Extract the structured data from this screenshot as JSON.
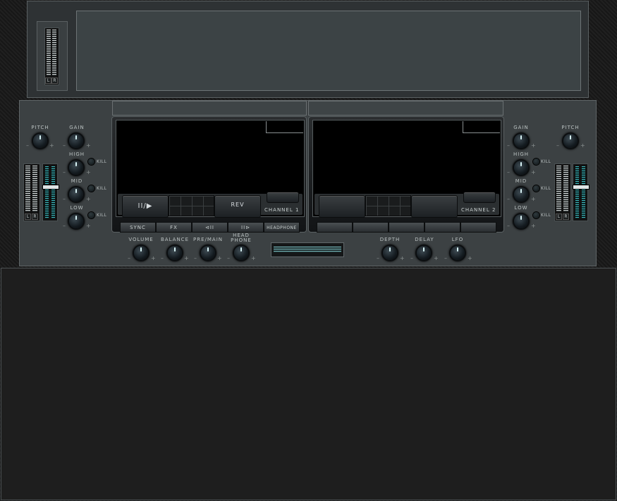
{
  "top_panel": {
    "meter_left": "L",
    "meter_right": "R"
  },
  "left_controls": {
    "pitch": "PITCH",
    "gain": "GAIN",
    "high": "HIGH",
    "mid": "MID",
    "low": "LOW",
    "kill": "KILL",
    "minus": "–",
    "plus": "+",
    "meter_left": "L",
    "meter_right": "R"
  },
  "right_controls": {
    "pitch": "PITCH",
    "gain": "GAIN",
    "high": "HIGH",
    "mid": "MID",
    "low": "LOW",
    "kill": "KILL",
    "minus": "–",
    "plus": "+",
    "meter_left": "L",
    "meter_right": "R"
  },
  "deck1": {
    "play_label": "II/▶",
    "rev_label": "REV",
    "channel_label": "CHANNEL 1",
    "strip": [
      "SYNC",
      "FX",
      "⊲II",
      "II⊳",
      "HEADPHONE"
    ]
  },
  "deck2": {
    "channel_label": "CHANNEL 2",
    "strip": [
      "",
      "",
      "",
      "",
      ""
    ]
  },
  "mixer": {
    "volume": "VOLUME",
    "balance": "BALANCE",
    "premain": "PRE/MAIN",
    "headphone_1": "HEAD",
    "headphone_2": "PHONE",
    "depth": "DEPTH",
    "delay": "DELAY",
    "lfo": "LFO",
    "minus": "–",
    "plus": "+"
  }
}
